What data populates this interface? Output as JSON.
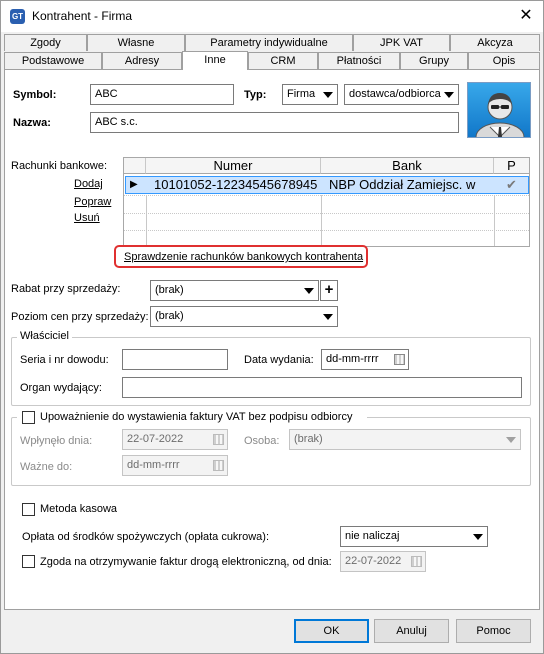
{
  "window": {
    "title": "Kontrahent - Firma",
    "close_icon": "close-icon",
    "app_icon_text": "GT"
  },
  "tabs_row1": [
    "Zgody",
    "Własne",
    "Parametry indywidualne",
    "JPK VAT",
    "Akcyza"
  ],
  "tabs_row2": [
    "Podstawowe",
    "Adresy",
    "Inne",
    "CRM",
    "Płatności",
    "Grupy",
    "Opis"
  ],
  "active_tab": "Inne",
  "header": {
    "symbol_label": "Symbol:",
    "symbol_value": "ABC",
    "typ_label": "Typ:",
    "typ_value": "Firma",
    "typ2_value": "dostawca/odbiorca",
    "nazwa_label": "Nazwa:",
    "nazwa_value": "ABC s.c."
  },
  "bank": {
    "label": "Rachunki bankowe:",
    "actions": [
      "Dodaj",
      "Popraw",
      "Usuń"
    ],
    "columns": [
      "Numer",
      "Bank",
      "P"
    ],
    "rows": [
      {
        "numer": "10101052-12234545678945",
        "bank": "NBP Oddział Zamiejsc. w",
        "primary": "✔"
      }
    ],
    "verify_link": "Sprawdzenie rachunków bankowych kontrahenta"
  },
  "rabat": {
    "label": "Rabat przy sprzedaży:",
    "value": "(brak)",
    "add": "+"
  },
  "poziom": {
    "label": "Poziom cen przy sprzedaży:",
    "value": "(brak)"
  },
  "wlasciciel": {
    "title": "Właściciel",
    "seria_label": "Seria i nr dowodu:",
    "seria_value": "",
    "data_label": "Data wydania:",
    "data_value": "dd-mm-rrrr",
    "organ_label": "Organ wydający:",
    "organ_value": ""
  },
  "upowaznienie": {
    "title": "Upoważnienie do wystawienia faktury VAT bez podpisu odbiorcy",
    "wplynelo_label": "Wpłynęło dnia:",
    "wplynelo_value": "22-07-2022",
    "osoba_label": "Osoba:",
    "osoba_value": "(brak)",
    "wazne_label": "Ważne do:",
    "wazne_value": "dd-mm-rrrr"
  },
  "metoda_kasowa": "Metoda kasowa",
  "oplata": {
    "label": "Opłata od środków spożywczych (opłata cukrowa):",
    "value": "nie naliczaj"
  },
  "zgoda": {
    "label": "Zgoda na otrzymywanie faktur drogą elektroniczną, od dnia:",
    "value": "22-07-2022"
  },
  "buttons": {
    "ok": "OK",
    "cancel": "Anuluj",
    "help": "Pomoc"
  }
}
